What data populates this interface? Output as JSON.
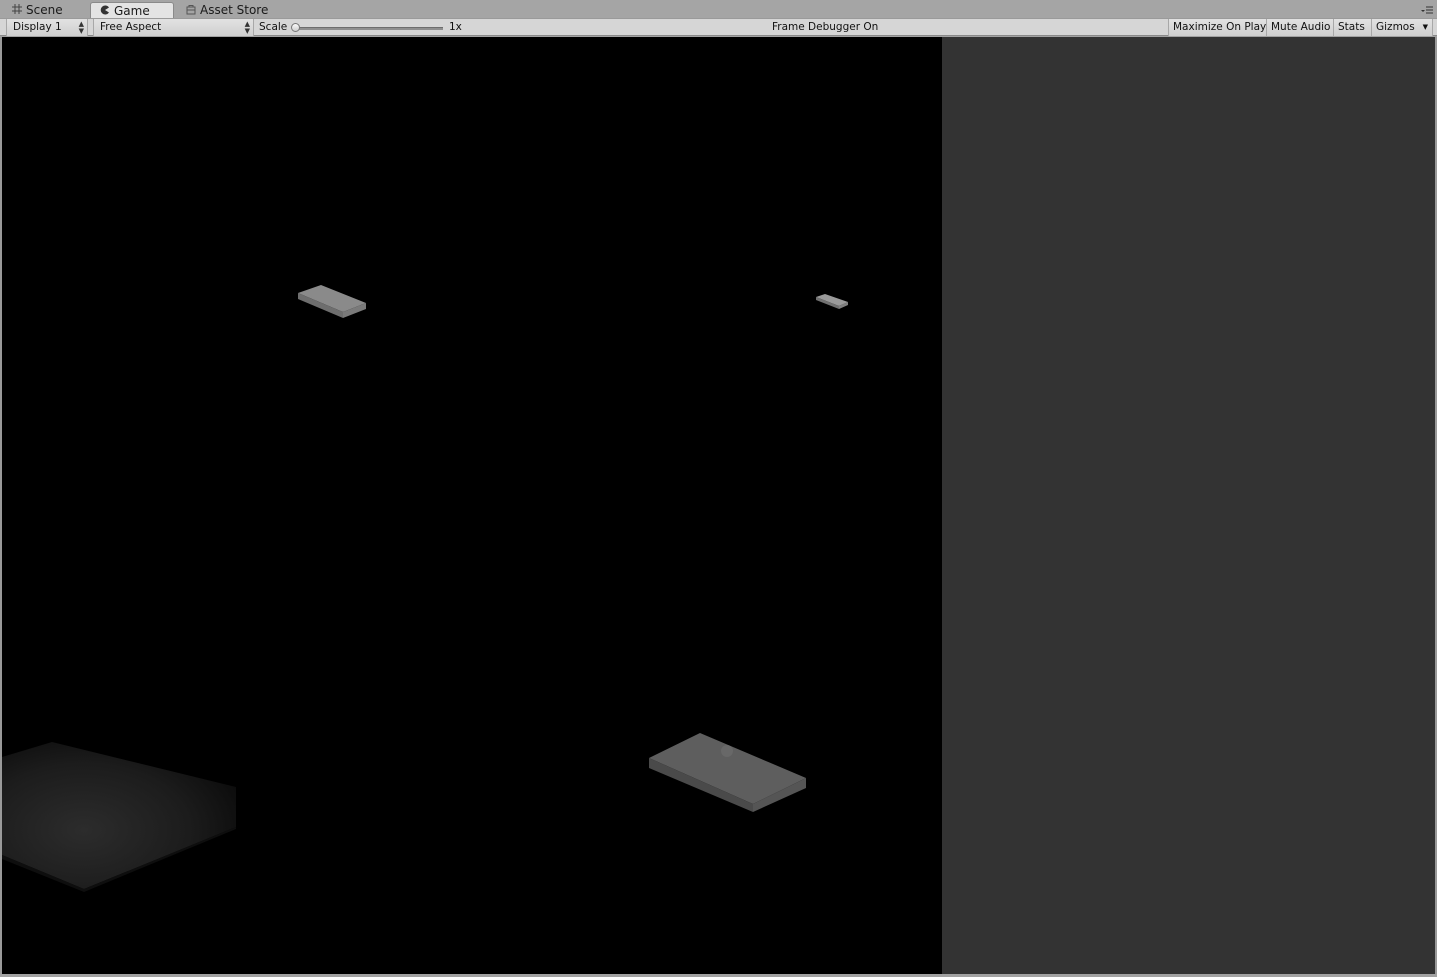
{
  "tabs": [
    {
      "label": "Scene",
      "icon": "grid-icon",
      "active": false
    },
    {
      "label": "Game",
      "icon": "pacman-icon",
      "active": true
    },
    {
      "label": "Asset Store",
      "icon": "store-bag-icon",
      "active": false
    }
  ],
  "toolbar": {
    "display": "Display 1",
    "aspect": "Free Aspect",
    "scale_label": "Scale",
    "scale_value": "1x",
    "frame_debugger": "Frame Debugger On",
    "maximize_on_play": "Maximize On Play",
    "mute_audio": "Mute Audio",
    "stats": "Stats",
    "gizmos": "Gizmos"
  },
  "colors": {
    "game_background": "#000000",
    "side_panel": "#333333",
    "toolbar": "#d6d6d6",
    "tab_active": "#e4e4e4",
    "tab_strip": "#a5a5a5"
  }
}
